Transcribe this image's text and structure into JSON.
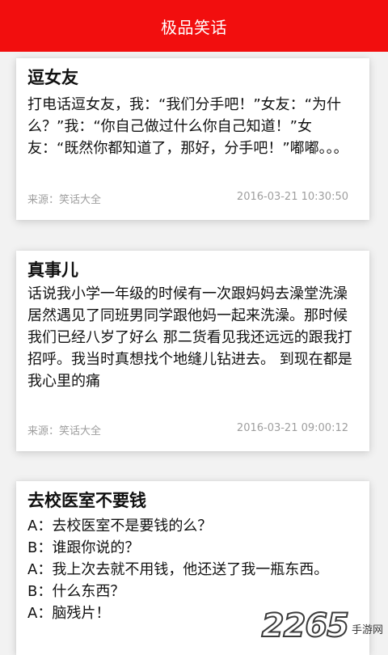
{
  "app_bar": {
    "title": "极品笑话"
  },
  "cards": [
    {
      "title": "逗女友",
      "body": [
        "打电话逗女友，我：“我们分手吧！”女友：“为什么？”我：“你自己做过什么你自己知道！”女友：“既然你都知道了，那好，分手吧！”嘟嘟。。。"
      ],
      "source": "来源：笑话大全",
      "time": "2016-03-21 10:30:50"
    },
    {
      "title": "真事儿",
      "body": [
        "话说我小学一年级的时候有一次跟妈妈去澡堂洗澡 居然遇见了同班男同学跟他妈一起来洗澡。那时候我们已经八岁了好么 那二货看见我还远远的跟我打招呼。我当时真想找个地缝儿钻进去。 到现在都是我心里的痛"
      ],
      "source": "来源：笑话大全",
      "time": "2016-03-21 09:00:12"
    },
    {
      "title": "去校医室不要钱",
      "body": [
        "A：去校医室不是要钱的么？",
        "B：谁跟你说的？",
        "A：我上次去就不用钱，他还送了我一瓶东西。",
        "B：什么东西？",
        "A：脑残片！"
      ]
    }
  ],
  "watermark": {
    "number": "2265",
    "text": "手游网"
  },
  "colors": {
    "app_bar": "#f20e0e",
    "meta_text": "#9e9e9e"
  }
}
